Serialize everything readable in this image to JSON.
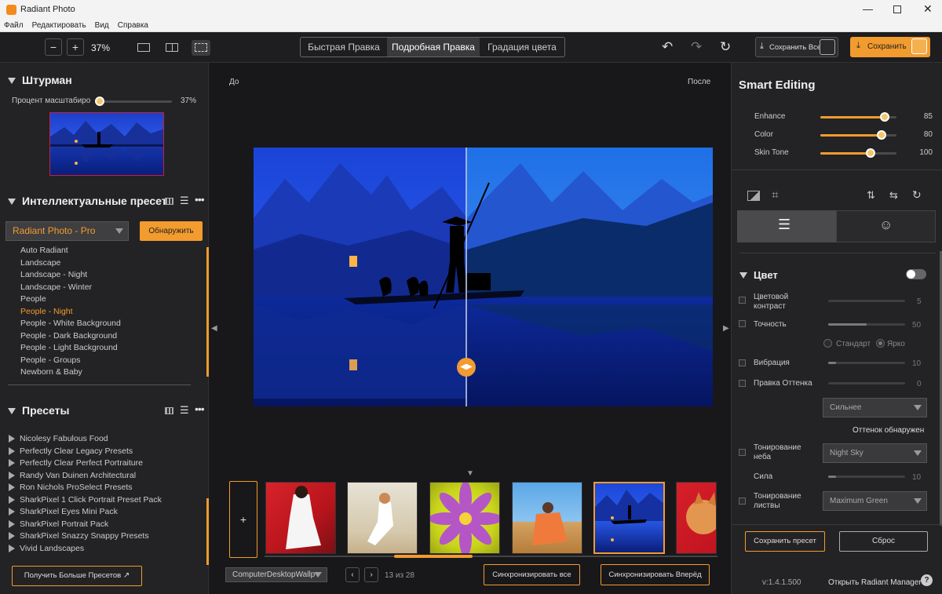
{
  "window": {
    "title": "Radiant Photo"
  },
  "menu": [
    "Файл",
    "Редактировать",
    "Вид",
    "Справка"
  ],
  "toolbar": {
    "zoom": "37%",
    "tabs": [
      "Быстрая Правка",
      "Подробная Правка",
      "Градация цвета"
    ],
    "save_all": "Сохранить Все",
    "save": "Сохранить"
  },
  "navigator": {
    "title": "Штурман",
    "scale_label": "Процент масштабиро",
    "scale_value": "37%",
    "scale_fraction": 0.37
  },
  "smart_presets": {
    "title": "Интеллектуальные пресеты",
    "dropdown": "Radiant Photo - Pro",
    "detect_button": "Обнаружить",
    "items": [
      "Auto Radiant",
      "Landscape",
      "Landscape - Night",
      "Landscape - Winter",
      "People",
      "People - Night",
      "People - White Background",
      "People - Dark Background",
      "People - Light Background",
      "People - Groups",
      "Newborn & Baby"
    ],
    "active_index": 5
  },
  "presets": {
    "title": "Пресеты",
    "items": [
      "Nicolesy Fabulous Food",
      "Perfectly Clear Legacy Presets",
      "Perfectly Clear Perfect Portraiture",
      "Randy Van Duinen Architectural",
      "Ron Nichols ProSelect Presets",
      "SharkPixel 1 Click Portrait Preset Pack",
      "SharkPixel Eyes Mini Pack",
      "SharkPixel Portrait Pack",
      "SharkPixel Snazzy Snappy Presets",
      "Vivid Landscapes"
    ],
    "more_button": "Получить Больше Пресетов"
  },
  "preview": {
    "before": "До",
    "after": "После"
  },
  "filmstrip": {
    "folder": "ComputerDesktopWallp",
    "counter": "13 из 28",
    "sync_all": "Синхронизировать все",
    "sync_forward": "Синхронизировать Вперёд"
  },
  "smart_editing": {
    "title": "Smart Editing",
    "sliders": [
      {
        "label": "Enhance",
        "value": "85",
        "fraction": 0.85
      },
      {
        "label": "Color",
        "value": "80",
        "fraction": 0.8
      },
      {
        "label": "Skin Tone",
        "value": "100",
        "fraction": 0.66
      }
    ]
  },
  "color_section": {
    "title": "Цвет",
    "contrast": {
      "label": "Цветовой контраст",
      "value": "5"
    },
    "accuracy": {
      "label": "Точность",
      "value": "50"
    },
    "radio": [
      "Стандарт",
      "Ярко"
    ],
    "vibrance": {
      "label": "Вибрация",
      "value": "10"
    },
    "tint": {
      "label": "Правка Оттенка",
      "value": "0"
    },
    "tint_dropdown": "Сильнее",
    "tint_detected": "Оттенок обнаружен",
    "sky": {
      "label": "Тонирование неба",
      "dropdown": "Night Sky"
    },
    "strength": {
      "label": "Сила",
      "value": "10"
    },
    "foliage": {
      "label": "Тонирование листвы",
      "dropdown": "Maximum Green"
    }
  },
  "footer": {
    "save_preset": "Сохранить пресет",
    "reset": "Сброс",
    "version": "v:1.4.1.500",
    "open_manager": "Открыть Radiant Manager"
  }
}
